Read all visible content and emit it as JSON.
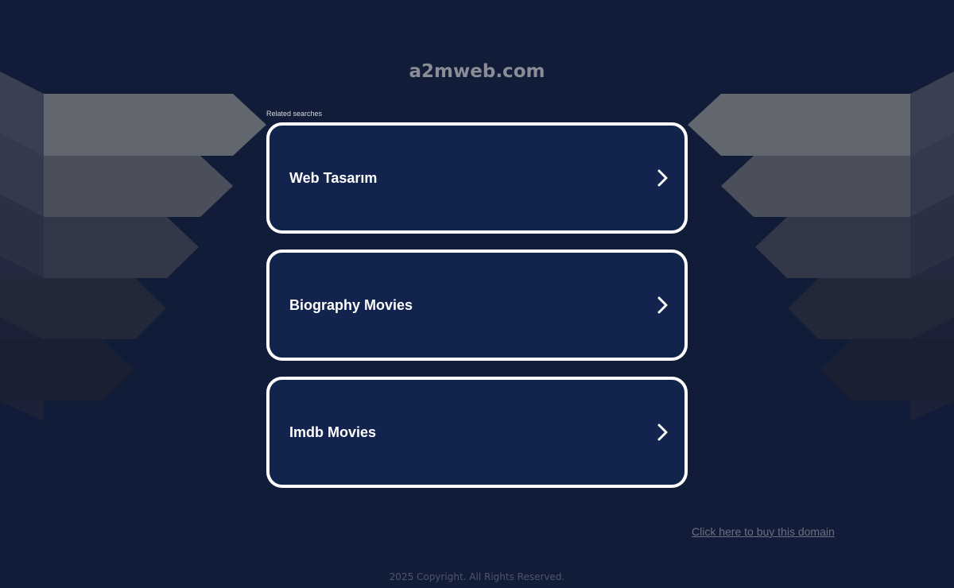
{
  "site": {
    "domain": "a2mweb.com"
  },
  "related_searches": {
    "label": "Related searches",
    "items": [
      {
        "label": "Web Tasarım"
      },
      {
        "label": "Biography Movies"
      },
      {
        "label": "Imdb Movies"
      }
    ]
  },
  "buy_domain": {
    "label": "Click here to buy this domain"
  },
  "footer": {
    "copyright": "2025 Copyright. All Rights Reserved."
  },
  "colors": {
    "background": "#111c38",
    "card_background": "#12244d",
    "card_border": "#ffffff",
    "title_text": "#8a8d96"
  }
}
